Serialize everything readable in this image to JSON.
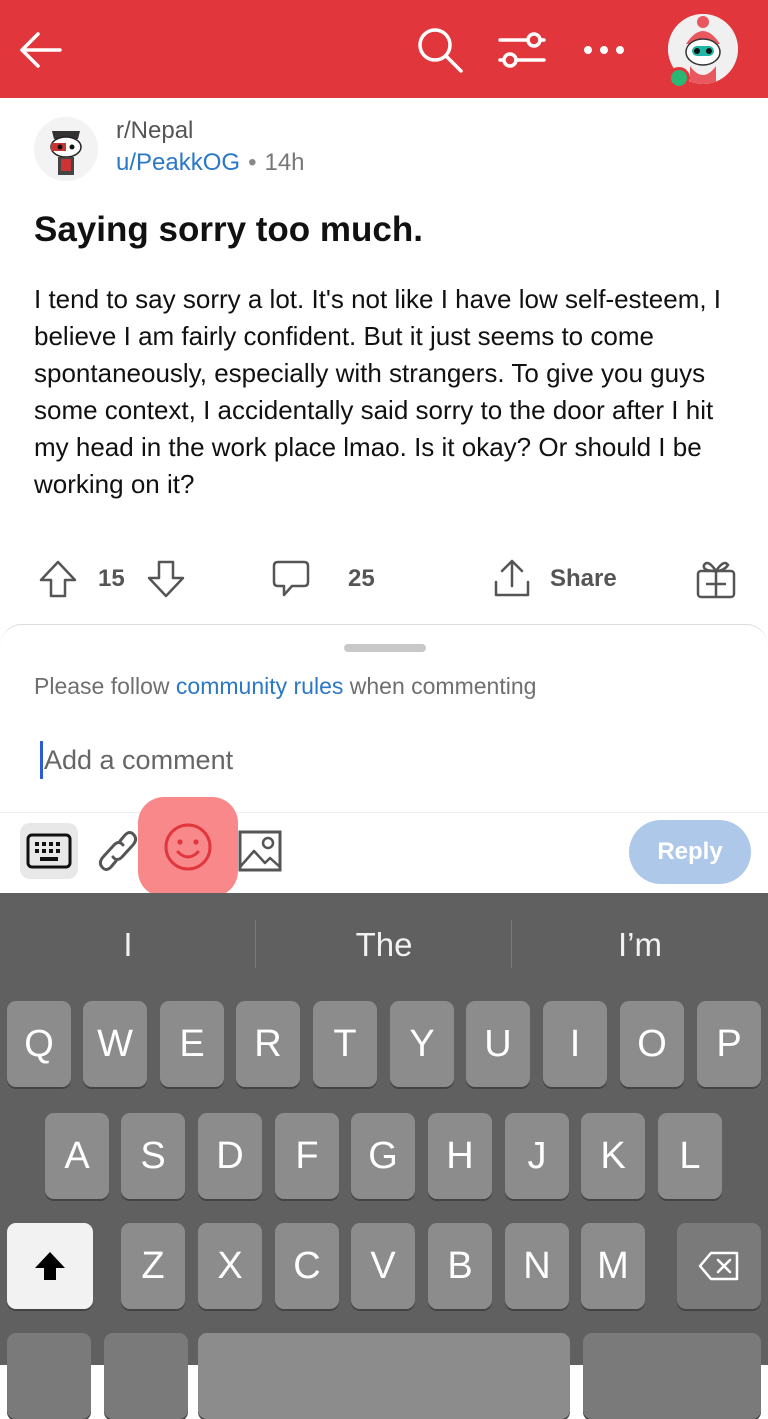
{
  "colors": {
    "topbar": "#e0363c",
    "link": "#2b77c8",
    "reply_bg": "#aec8ea",
    "emoji_highlight": "#f9888a",
    "keyboard_bg": "#606060"
  },
  "topbar": {
    "icons": [
      "back-arrow-icon",
      "search-icon",
      "sort-filter-icon",
      "more-icon",
      "profile-avatar-icon"
    ]
  },
  "post": {
    "subreddit": "r/Nepal",
    "author": "u/PeakkOG",
    "separator": "•",
    "time": "14h",
    "title": "Saying sorry too much.",
    "body": "I tend to say sorry a lot. It's not like I have low self-esteem, I believe I am fairly confident. But it just seems to come spontaneously, especially with strangers. To give you guys some context, I accidentally said sorry to the door after I hit my head in the work place lmao. Is it okay? Or should I be working on it?",
    "upvotes": "15",
    "comments": "25",
    "share_label": "Share"
  },
  "composer": {
    "rules_prefix": "Please follow",
    "rules_link": "community rules",
    "rules_suffix": "when commenting",
    "placeholder": "Add a comment",
    "reply_label": "Reply"
  },
  "keyboard": {
    "suggestions": [
      "I",
      "The",
      "I’m"
    ],
    "row1": [
      "Q",
      "W",
      "E",
      "R",
      "T",
      "Y",
      "U",
      "I",
      "O",
      "P"
    ],
    "row2": [
      "A",
      "S",
      "D",
      "F",
      "G",
      "H",
      "J",
      "K",
      "L"
    ],
    "row3": [
      "Z",
      "X",
      "C",
      "V",
      "B",
      "N",
      "M"
    ]
  }
}
